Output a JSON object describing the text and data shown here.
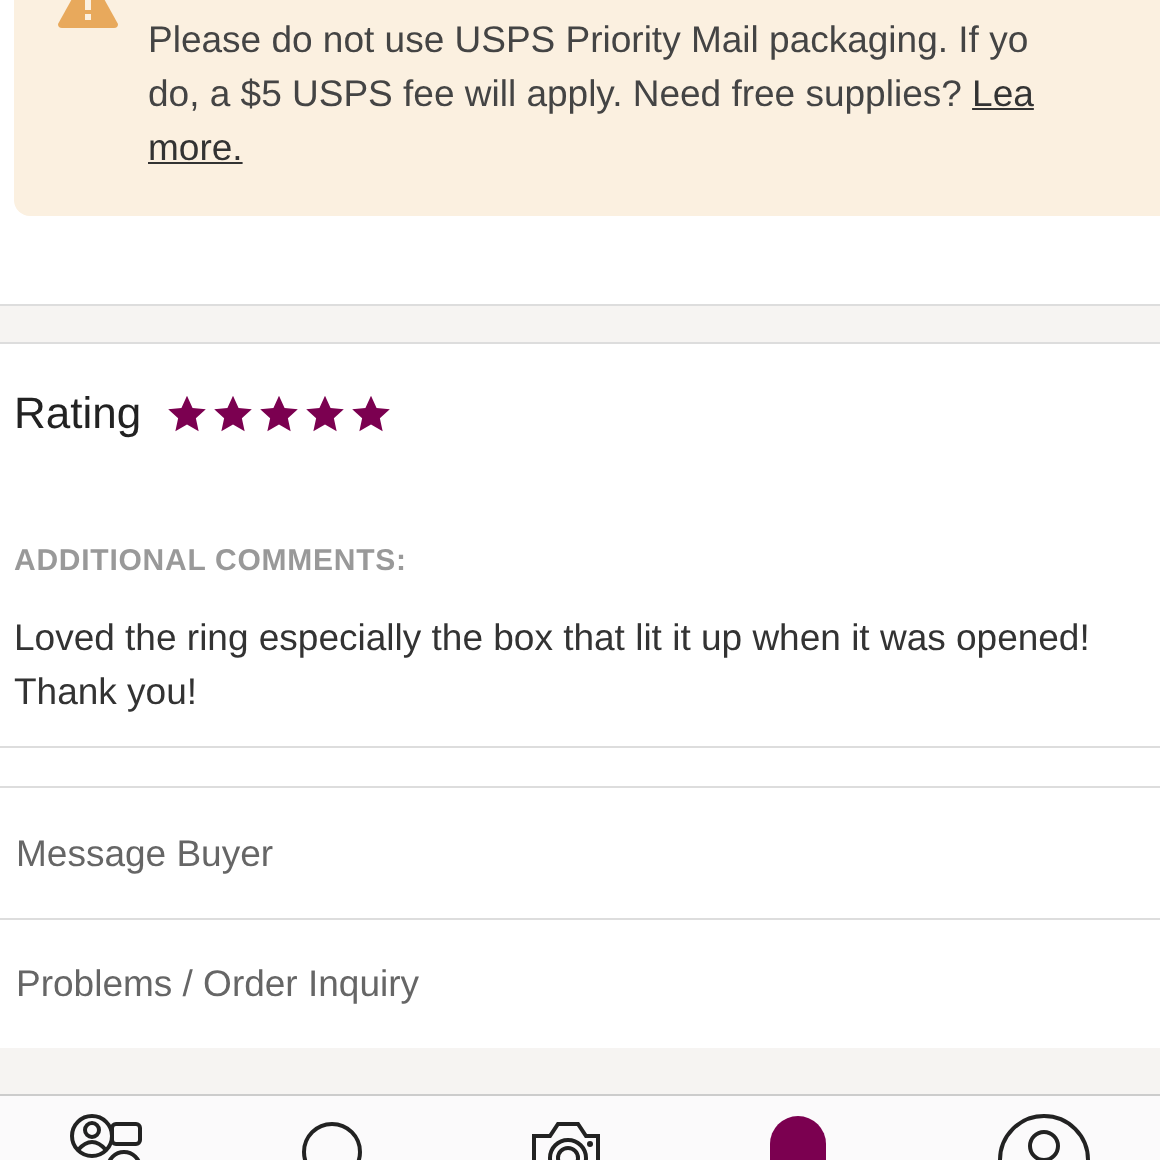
{
  "notice": {
    "lines": [
      "Please do not use USPS Priority Mail packaging. If yo",
      "do, a $5 USPS fee will apply. Need free supplies?"
    ],
    "link_parts": [
      "Lea",
      "more."
    ]
  },
  "rating": {
    "label": "Rating",
    "stars": 5
  },
  "comments": {
    "heading": "ADDITIONAL COMMENTS:",
    "text": "Loved the ring especially the box that lit it up when it was opened! Thank you!"
  },
  "actions": [
    "Message Buyer",
    "Problems / Order Inquiry"
  ],
  "nav": [
    {
      "kind": "feed",
      "selected": false
    },
    {
      "kind": "search",
      "selected": false
    },
    {
      "kind": "camera",
      "selected": false
    },
    {
      "kind": "news",
      "selected": true
    },
    {
      "kind": "account",
      "selected": false
    }
  ]
}
